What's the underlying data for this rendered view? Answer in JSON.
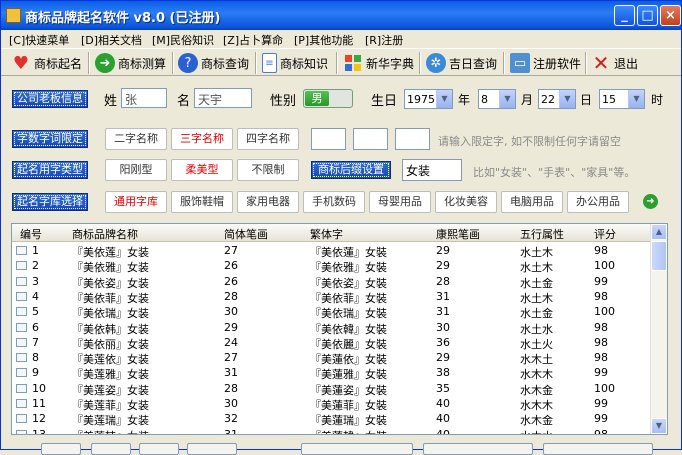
{
  "window": {
    "title": "商标品牌起名软件 v8.0 (已注册)",
    "min": "_",
    "max": "□",
    "close": "×"
  },
  "menu": [
    "[C]快速菜单",
    "[D]相关文档",
    "[M]民俗知识",
    "[Z]占卜算命",
    "[P]其他功能",
    "[R]注册"
  ],
  "toolbar": [
    {
      "label": "商标起名",
      "icon": "heart-icon",
      "color": "#e03030"
    },
    {
      "label": "商标测算",
      "icon": "arrow-icon",
      "color": "#2aa030"
    },
    {
      "label": "商标查询",
      "icon": "help-icon",
      "color": "#2a60d0"
    },
    {
      "label": "商标知识",
      "icon": "document-icon",
      "color": "#4a7ec8"
    },
    {
      "label": "新华字典",
      "icon": "windows-icon",
      "color": "#e0a020"
    },
    {
      "label": "吉日查询",
      "icon": "globe-icon",
      "color": "#3a8ad8"
    },
    {
      "label": "注册软件",
      "icon": "monitor-icon",
      "color": "#5090d0"
    },
    {
      "label": "退出",
      "icon": "exit-icon",
      "color": "#d02020"
    }
  ],
  "owner": {
    "button": "公司老板信息",
    "surname_label": "姓",
    "surname": "张",
    "given_label": "名",
    "given": "天宇",
    "gender_label": "性别",
    "gender": "男",
    "birth_label": "生日",
    "year": "1975",
    "year_unit": "年",
    "month": "8",
    "month_unit": "月",
    "day": "22",
    "day_unit": "日",
    "hour": "15",
    "hour_unit": "时"
  },
  "limit": {
    "button": "字数字词限定",
    "options": [
      "二字名称",
      "三字名称",
      "四字名称"
    ],
    "hint": "请输入限定字, 如不限制任何字请留空"
  },
  "type": {
    "button": "起名用字类型",
    "options": [
      "阳刚型",
      "柔美型",
      "不限制"
    ],
    "suffix_button": "商标后缀设置",
    "suffix_value": "女装",
    "hint": "比如\"女装\"、\"手表\"、\"家具\"等。"
  },
  "library": {
    "button": "起名字库选择",
    "options": [
      "通用字库",
      "服饰鞋帽",
      "家用电器",
      "手机数码",
      "母婴用品",
      "化妆美容",
      "电脑用品",
      "办公用品"
    ]
  },
  "table": {
    "headers": [
      "编号",
      "商标品牌名称",
      "简体笔画",
      "繁体字",
      "康熙笔画",
      "五行属性",
      "评分"
    ],
    "rows": [
      [
        "1",
        "『美依莲』女装",
        "27",
        "『美依蓮』女裝",
        "29",
        "水土木",
        "98"
      ],
      [
        "2",
        "『美依雅』女装",
        "26",
        "『美依雅』女裝",
        "29",
        "水土木",
        "100"
      ],
      [
        "3",
        "『美依姿』女装",
        "26",
        "『美依姿』女裝",
        "28",
        "水土金",
        "99"
      ],
      [
        "4",
        "『美依菲』女装",
        "28",
        "『美依菲』女裝",
        "31",
        "水土木",
        "98"
      ],
      [
        "5",
        "『美依瑞』女装",
        "30",
        "『美依瑞』女裝",
        "31",
        "水土金",
        "100"
      ],
      [
        "6",
        "『美依韩』女装",
        "29",
        "『美依韓』女裝",
        "30",
        "水土水",
        "98"
      ],
      [
        "7",
        "『美依丽』女装",
        "24",
        "『美依麗』女裝",
        "36",
        "水土火",
        "98"
      ],
      [
        "8",
        "『美莲依』女装",
        "27",
        "『美蓮依』女裝",
        "29",
        "水木土",
        "98"
      ],
      [
        "9",
        "『美莲雅』女装",
        "31",
        "『美蓮雅』女裝",
        "38",
        "水木木",
        "99"
      ],
      [
        "10",
        "『美莲姿』女装",
        "28",
        "『美蓮姿』女裝",
        "35",
        "水木金",
        "100"
      ],
      [
        "11",
        "『美莲菲』女装",
        "30",
        "『美蓮菲』女裝",
        "40",
        "水木木",
        "99"
      ],
      [
        "12",
        "『美莲瑞』女装",
        "32",
        "『美蓮瑞』女裝",
        "40",
        "水木金",
        "99"
      ],
      [
        "13",
        "『美莲韩』女装",
        "31",
        "『美蓮韓』女裝",
        "40",
        "水木水",
        "98"
      ]
    ]
  }
}
